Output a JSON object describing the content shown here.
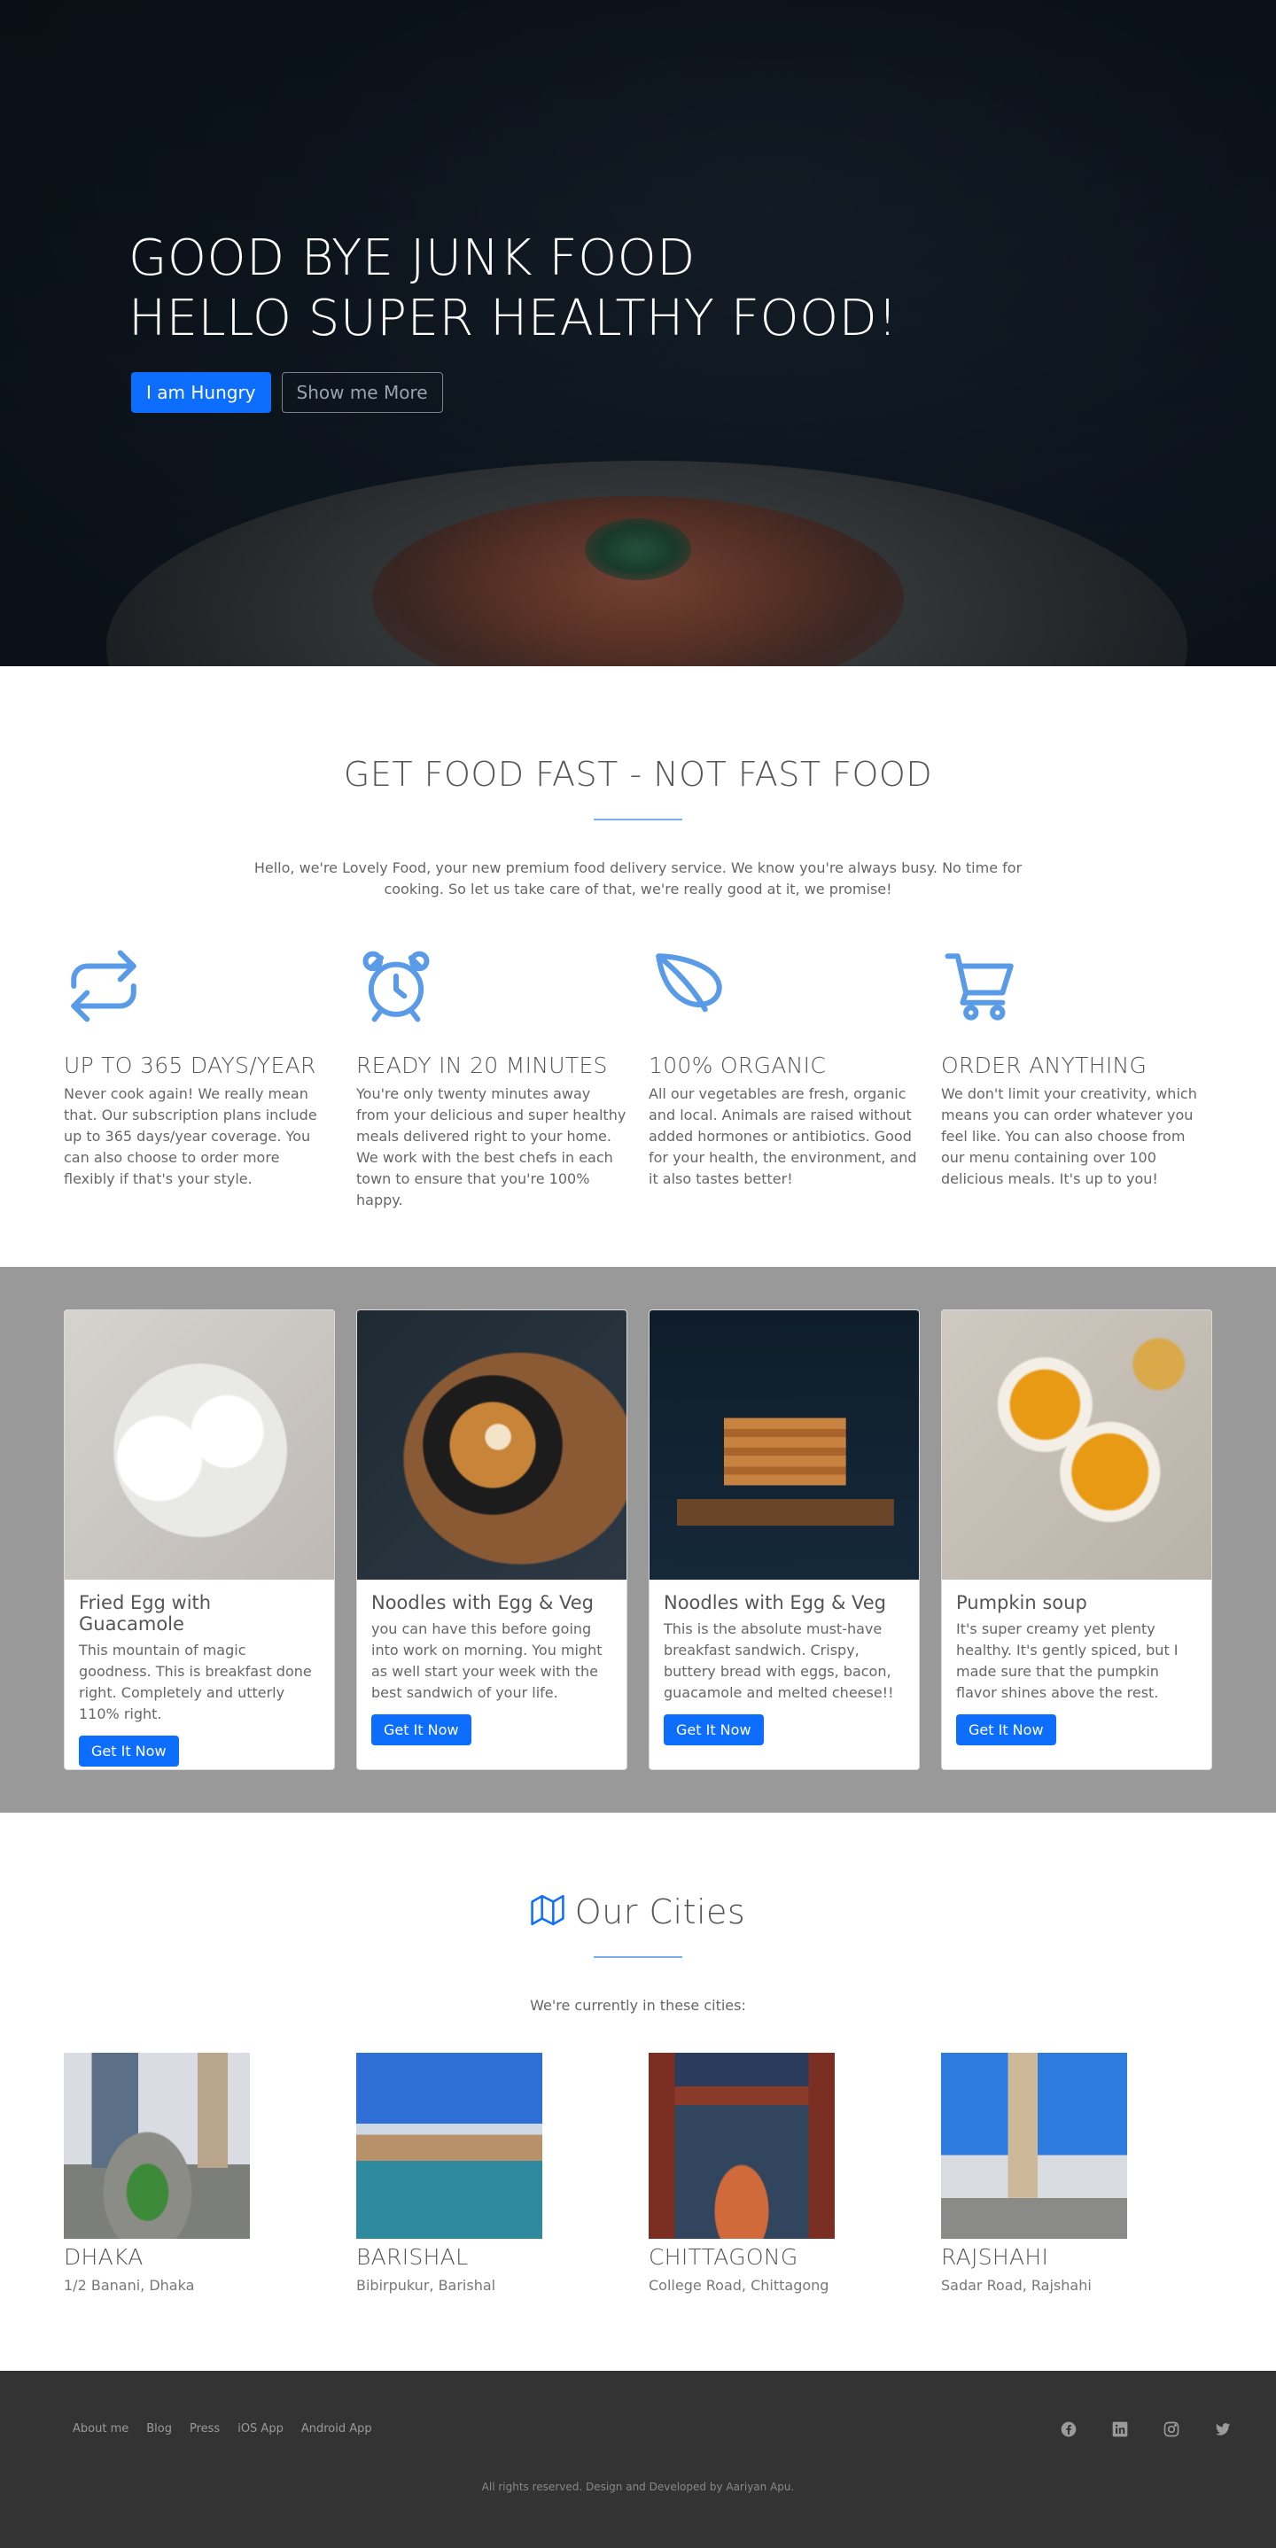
{
  "hero": {
    "title_line1": "GOOD BYE JUNK FOOD",
    "title_line2": "HELLO SUPER HEALTHY FOOD!",
    "primary_button": "I am Hungry",
    "secondary_button": "Show me More"
  },
  "features": {
    "title": "GET FOOD FAST - NOT FAST FOOD",
    "intro": "Hello, we're Lovely Food, your new premium food delivery service. We know you're always busy. No time for cooking. So let us take care of that, we're really good at it, we promise!",
    "items": [
      {
        "icon": "repeat-icon",
        "title": "UP TO 365 DAYS/YEAR",
        "text": "Never cook again! We really mean that. Our subscription plans include up to 365 days/year coverage. You can also choose to order more flexibly if that's your style."
      },
      {
        "icon": "alarm-clock-icon",
        "title": "READY IN 20 MINUTES",
        "text": "You're only twenty minutes away from your delicious and super healthy meals delivered right to your home. We work with the best chefs in each town to ensure that you're 100% happy."
      },
      {
        "icon": "leaf-icon",
        "title": "100% ORGANIC",
        "text": "All our vegetables are fresh, organic and local. Animals are raised without added hormones or antibiotics. Good for your health, the environment, and it also tastes better!"
      },
      {
        "icon": "cart-icon",
        "title": "ORDER ANYTHING",
        "text": "We don't limit your creativity, which means you can order whatever you feel like. You can also choose from our menu containing over 100 delicious meals. It's up to you!"
      }
    ]
  },
  "meals": [
    {
      "title": "Fried Egg with Guacamole",
      "text": "This mountain of magic goodness. This is breakfast done right. Completely and utterly 110% right.",
      "button": "Get It Now"
    },
    {
      "title": "Noodles with Egg & Veg",
      "text": "you can have this before going into work on morning. You might as well start your week with the best sandwich of your life.",
      "button": "Get It Now"
    },
    {
      "title": "Noodles with Egg & Veg",
      "text": "This is the absolute must-have breakfast sandwich. Crispy, buttery bread with eggs, bacon, guacamole and melted cheese!!",
      "button": "Get It Now"
    },
    {
      "title": "Pumpkin soup",
      "text": "It's super creamy yet plenty healthy. It's gently spiced, but I made sure that the pumpkin flavor shines above the rest.",
      "button": "Get It Now"
    }
  ],
  "cities": {
    "title": "Our Cities",
    "intro": "We're currently in these cities:",
    "items": [
      {
        "name": "DHAKA",
        "address": "1/2 Banani, Dhaka"
      },
      {
        "name": "BARISHAL",
        "address": "Bibirpukur, Barishal"
      },
      {
        "name": "CHITTAGONG",
        "address": "College Road, Chittagong"
      },
      {
        "name": "RAJSHAHI",
        "address": "Sadar Road, Rajshahi"
      }
    ]
  },
  "footer": {
    "links": [
      "About me",
      "Blog",
      "Press",
      "iOS App",
      "Android App"
    ],
    "social_icons": [
      "facebook-icon",
      "linkedin-icon",
      "instagram-icon",
      "twitter-icon"
    ],
    "copyright": "All rights reserved. Design and Developed by Aariyan Apu."
  },
  "colors": {
    "accent": "#0d6efd",
    "icon_blue": "#5a9be8",
    "meals_bg": "#999999",
    "footer_bg": "#333333"
  }
}
